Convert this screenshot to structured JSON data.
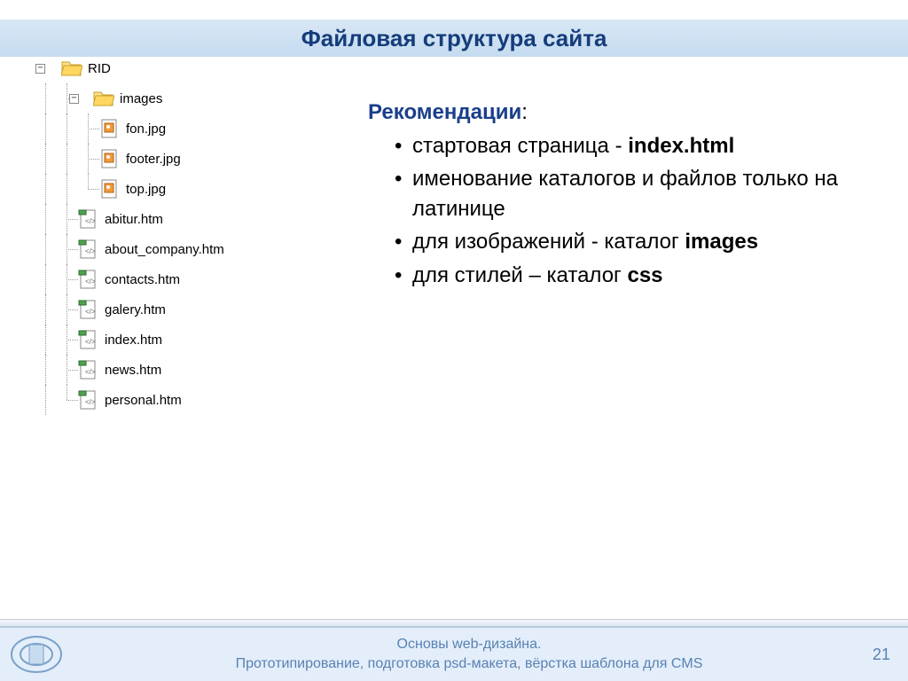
{
  "title": "Файловая структура сайта",
  "tree": {
    "root": {
      "label": "RID",
      "toggle": "−"
    },
    "images": {
      "label": "images",
      "toggle": "−"
    },
    "img_files": [
      {
        "label": "fon.jpg"
      },
      {
        "label": "footer.jpg"
      },
      {
        "label": "top.jpg"
      }
    ],
    "htm_files": [
      {
        "label": "abitur.htm"
      },
      {
        "label": "about_company.htm"
      },
      {
        "label": "contacts.htm"
      },
      {
        "label": "galery.htm"
      },
      {
        "label": "index.htm"
      },
      {
        "label": "news.htm"
      },
      {
        "label": "personal.htm"
      }
    ]
  },
  "recs": {
    "title": "Рекомендации",
    "items": [
      {
        "pre": "стартовая страница - ",
        "bold": "index.html",
        "post": ""
      },
      {
        "pre": "именование каталогов и файлов только на латинице",
        "bold": "",
        "post": ""
      },
      {
        "pre": "для изображений - каталог ",
        "bold": "images",
        "post": ""
      },
      {
        "pre": "для стилей – каталог ",
        "bold": "css",
        "post": ""
      }
    ]
  },
  "footer": {
    "line1": "Основы web-дизайна.",
    "line2": "Прототипирование, подготовка psd-макета, вёрстка шаблона для CMS",
    "page": "21"
  }
}
